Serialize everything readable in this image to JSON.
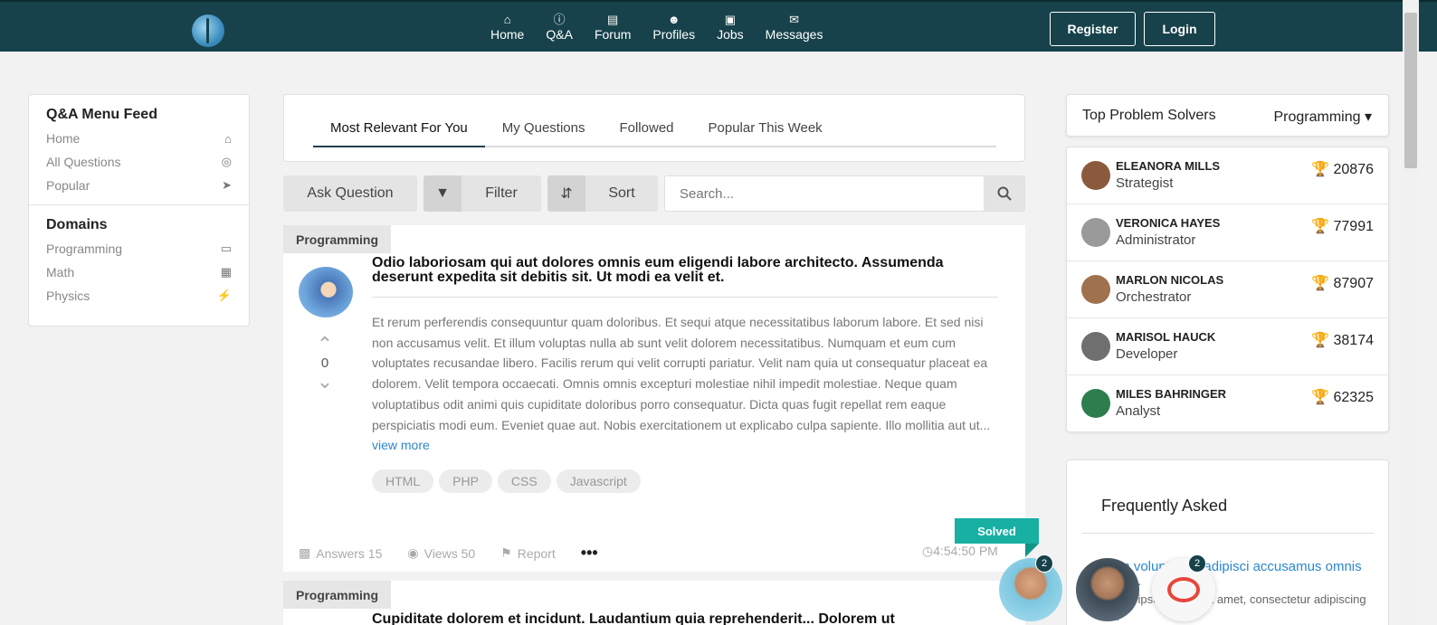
{
  "topbar": {
    "nav": [
      {
        "label": "Home",
        "icon": "home-icon"
      },
      {
        "label": "Q&A",
        "icon": "question-icon"
      },
      {
        "label": "Forum",
        "icon": "forum-icon"
      },
      {
        "label": "Profiles",
        "icon": "profiles-icon"
      },
      {
        "label": "Jobs",
        "icon": "jobs-icon"
      },
      {
        "label": "Messages",
        "icon": "messages-icon"
      }
    ],
    "register": "Register",
    "login": "Login"
  },
  "left": {
    "feed_title": "Q&A Menu Feed",
    "feed_items": [
      {
        "label": "Home",
        "icon": "home-icon"
      },
      {
        "label": "All Questions",
        "icon": "globe-icon"
      },
      {
        "label": "Popular",
        "icon": "paper-plane-icon"
      }
    ],
    "domains_title": "Domains",
    "domains": [
      {
        "label": "Programming",
        "icon": "monitor-icon"
      },
      {
        "label": "Math",
        "icon": "calculator-icon"
      },
      {
        "label": "Physics",
        "icon": "bolt-icon"
      }
    ]
  },
  "tabs": [
    "Most Relevant For You",
    "My Questions",
    "Followed",
    "Popular This Week"
  ],
  "actions": {
    "ask": "Ask Question",
    "filter": "Filter",
    "sort": "Sort",
    "search_placeholder": "Search..."
  },
  "question": {
    "domain": "Programming",
    "title": "Odio laboriosam qui aut dolores omnis eum eligendi labore architecto. Assumenda deserunt expedita sit debitis sit. Ut modi ea velit et.",
    "votes": "0",
    "body": "Et rerum perferendis consequuntur quam doloribus. Et sequi atque necessitatibus laborum labore. Et sed nisi non accusamus velit. Et illum voluptas nulla ab sunt velit dolorem necessitatibus. Numquam et eum cum voluptates recusandae libero. Facilis rerum qui velit corrupti pariatur. Velit nam quia ut consequatur placeat ea dolorem. Velit tempora occaecati. Omnis omnis excepturi molestiae nihil impedit molestiae. Neque quam voluptatibus odit animi quis cupiditate doloribus porro consequatur. Dicta quas fugit repellat rem eaque perspiciatis modi eum. Eveniet quae aut. Nobis exercitationem ut explicabo culpa sapiente. Illo mollitia aut ut...",
    "view_more": "view more",
    "tags": [
      "HTML",
      "PHP",
      "CSS",
      "Javascript"
    ],
    "status": "Solved",
    "answers": "Answers 15",
    "views": "Views 50",
    "report": "Report",
    "more": "•••",
    "time": "4:54:50 PM"
  },
  "question2": {
    "domain": "Programming",
    "title": "Cupiditate dolorem et incidunt. Laudantium quia reprehenderit... Dolorem ut"
  },
  "solvers": {
    "title": "Top Problem Solvers",
    "filter": "Programming",
    "list": [
      {
        "name": "ELEANORA MILLS",
        "role": "Strategist",
        "score": "20876",
        "avatar_color": "#8b5a3c"
      },
      {
        "name": "VERONICA HAYES",
        "role": "Administrator",
        "score": "77991",
        "avatar_color": "#9a9a9a"
      },
      {
        "name": "MARLON NICOLAS",
        "role": "Orchestrator",
        "score": "87907",
        "avatar_color": "#a0714f"
      },
      {
        "name": "MARISOL HAUCK",
        "role": "Developer",
        "score": "38174",
        "avatar_color": "#6f6f6f"
      },
      {
        "name": "MILES BAHRINGER",
        "role": "Analyst",
        "score": "62325",
        "avatar_color": "#2e7d4f"
      }
    ]
  },
  "faq": {
    "title": "Frequently Asked",
    "link": "Illum voluptatem adipisci accusamus omnis omnis.",
    "sub": "Lorem ipsum dolor sit amet, consectetur adipiscing elit."
  },
  "chat": {
    "badge1": "2",
    "badge3": "2"
  },
  "colors": {
    "brand": "#17424b",
    "solved": "#17b0a3",
    "link": "#2a87d0"
  }
}
